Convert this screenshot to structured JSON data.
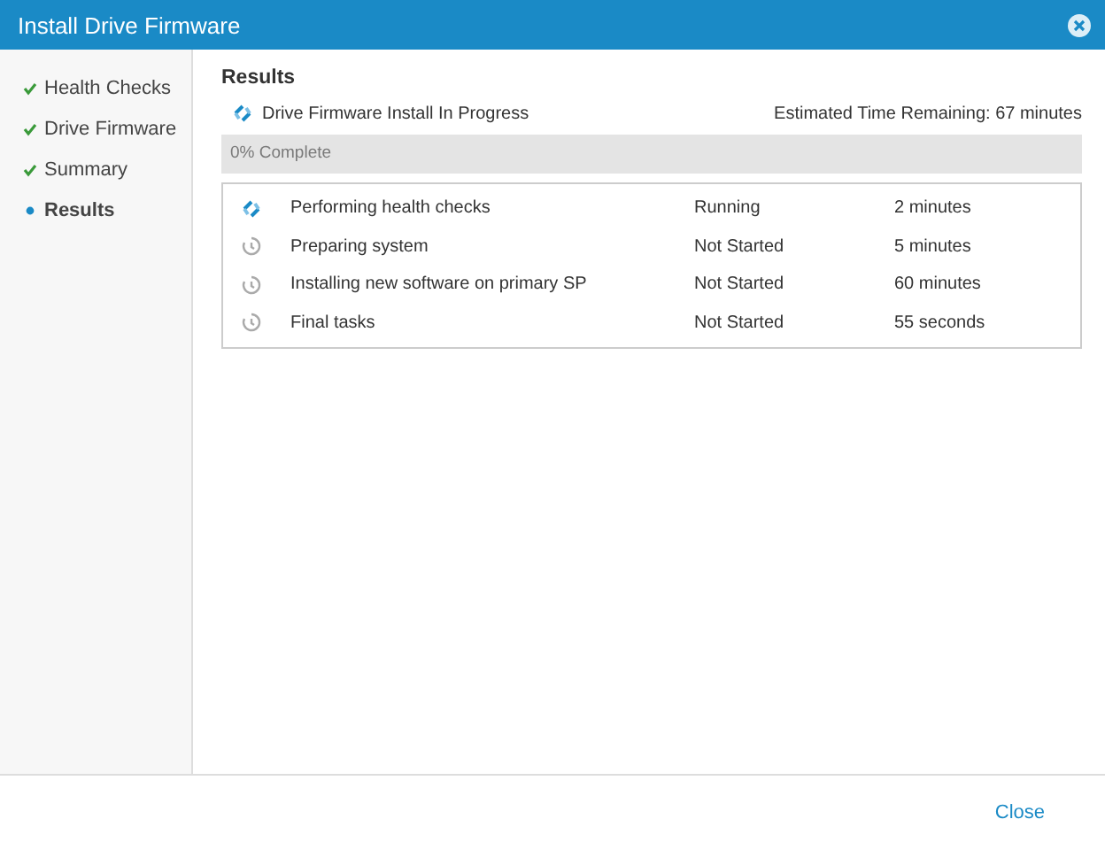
{
  "window": {
    "title": "Install Drive Firmware"
  },
  "steps": [
    {
      "label": "Health Checks",
      "kind": "done"
    },
    {
      "label": "Drive Firmware",
      "kind": "done"
    },
    {
      "label": "Summary",
      "kind": "done"
    },
    {
      "label": "Results",
      "kind": "current"
    }
  ],
  "results": {
    "heading": "Results",
    "status": "Drive Firmware Install In Progress",
    "estimate": "Estimated Time Remaining: 67 minutes",
    "progress": {
      "label": "0% Complete",
      "level": 0
    },
    "tasks": [
      {
        "name": "Performing health checks",
        "status": "Running",
        "duration": "2 minutes",
        "kind": "running"
      },
      {
        "name": "Preparing system",
        "status": "Not Started",
        "duration": "5 minutes",
        "kind": "pending"
      },
      {
        "name": "Installing new software on primary SP",
        "status": "Not Started",
        "duration": "60 minutes",
        "kind": "pending"
      },
      {
        "name": "Final tasks",
        "status": "Not Started",
        "duration": "55 seconds",
        "kind": "pending"
      }
    ]
  },
  "footer": {
    "close": "Close"
  }
}
